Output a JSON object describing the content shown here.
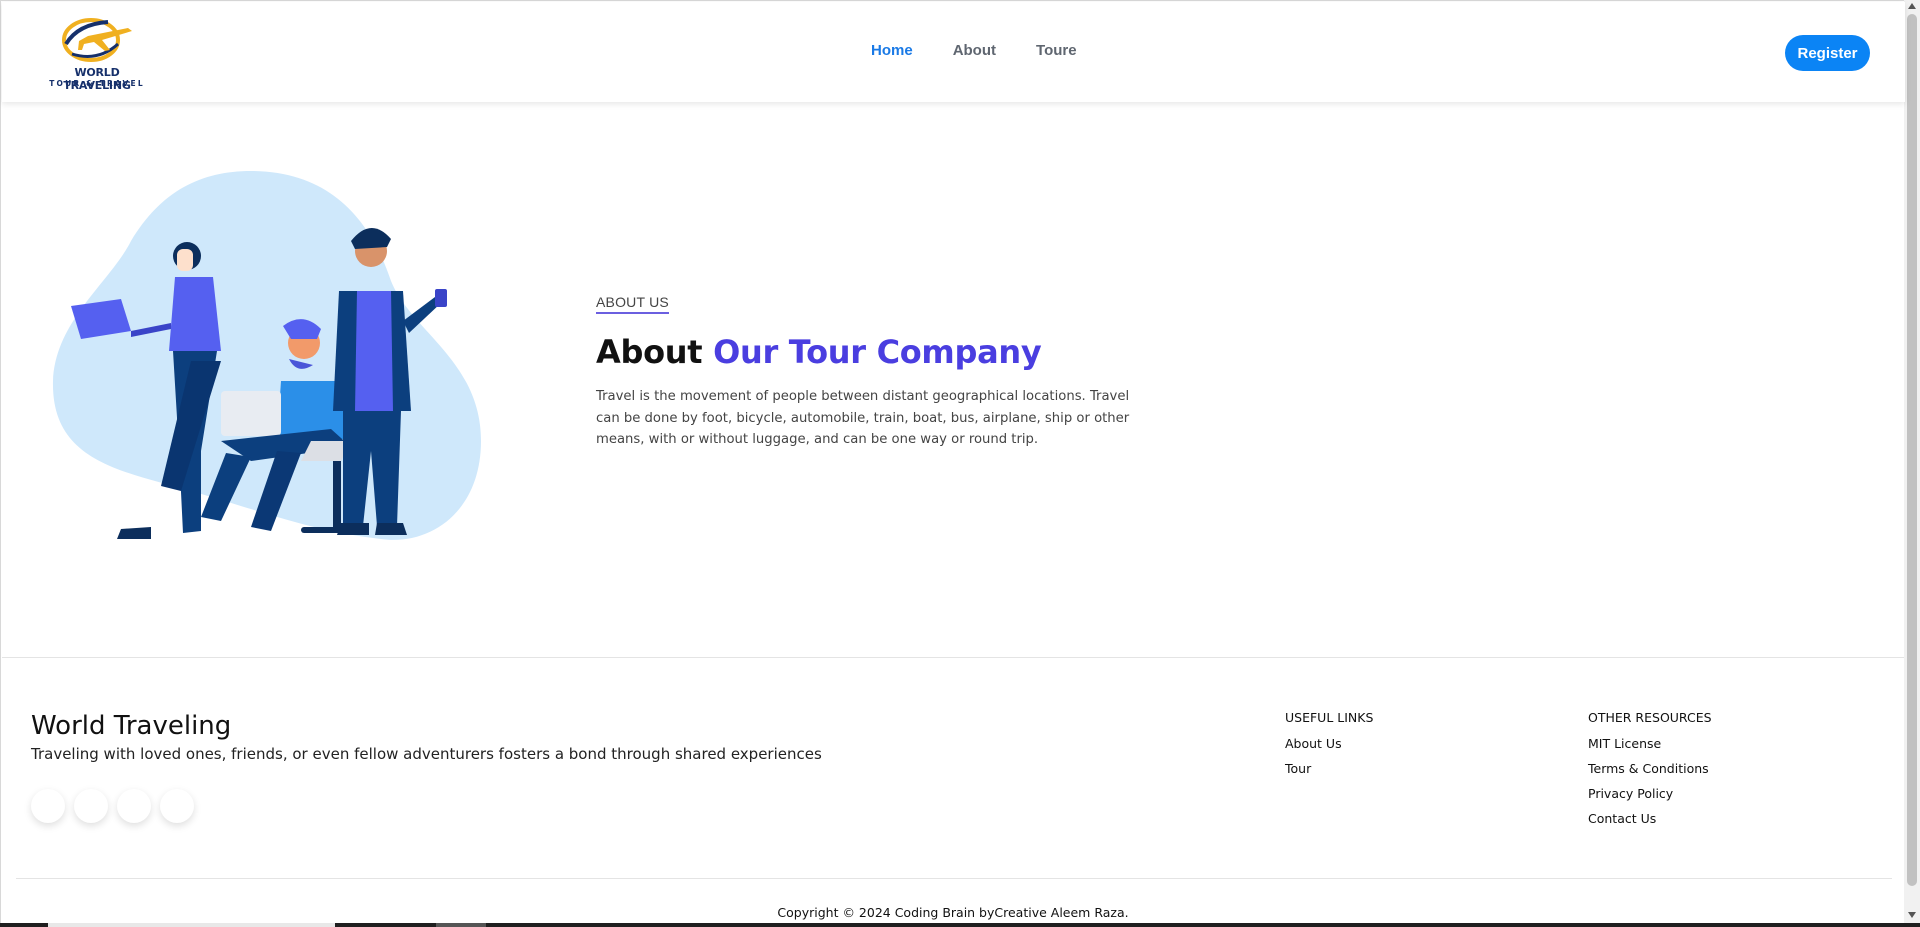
{
  "header": {
    "logo": {
      "line1": "WORLD TRAVELING",
      "line2": "TOUR & TRAVEL"
    },
    "nav": [
      {
        "label": "Home",
        "active": true
      },
      {
        "label": "About",
        "active": false
      },
      {
        "label": "Toure",
        "active": false
      }
    ],
    "register_label": "Register"
  },
  "about": {
    "eyebrow": "ABOUT US",
    "heading_plain": "About",
    "heading_accent": "Our Tour Company",
    "description": "Travel is the movement of people between distant geographical locations. Travel can be done by foot, bicycle, automobile, train, boat, bus, airplane, ship or other means, with or without luggage, and can be one way or round trip."
  },
  "footer": {
    "brand": "World Traveling",
    "tagline": "Traveling with loved ones, friends, or even fellow adventurers fosters a bond through shared experiences",
    "useful_links": {
      "title": "USEFUL LINKS",
      "items": [
        "About Us",
        "Tour"
      ]
    },
    "other_resources": {
      "title": "OTHER RESOURCES",
      "items": [
        "MIT License",
        "Terms & Conditions",
        "Privacy Policy",
        "Contact Us"
      ]
    },
    "copyright": "Copyright © 2024 Coding Brain byCreative Aleem Raza."
  },
  "colors": {
    "primary": "#0b84f5",
    "nav_active": "#1a7ae6",
    "accent": "#4a3ee0",
    "blob": "#cfe8fb"
  },
  "icons": [
    "airplane-logo-icon",
    "scroll-up-arrow-icon",
    "scroll-down-arrow-icon"
  ]
}
